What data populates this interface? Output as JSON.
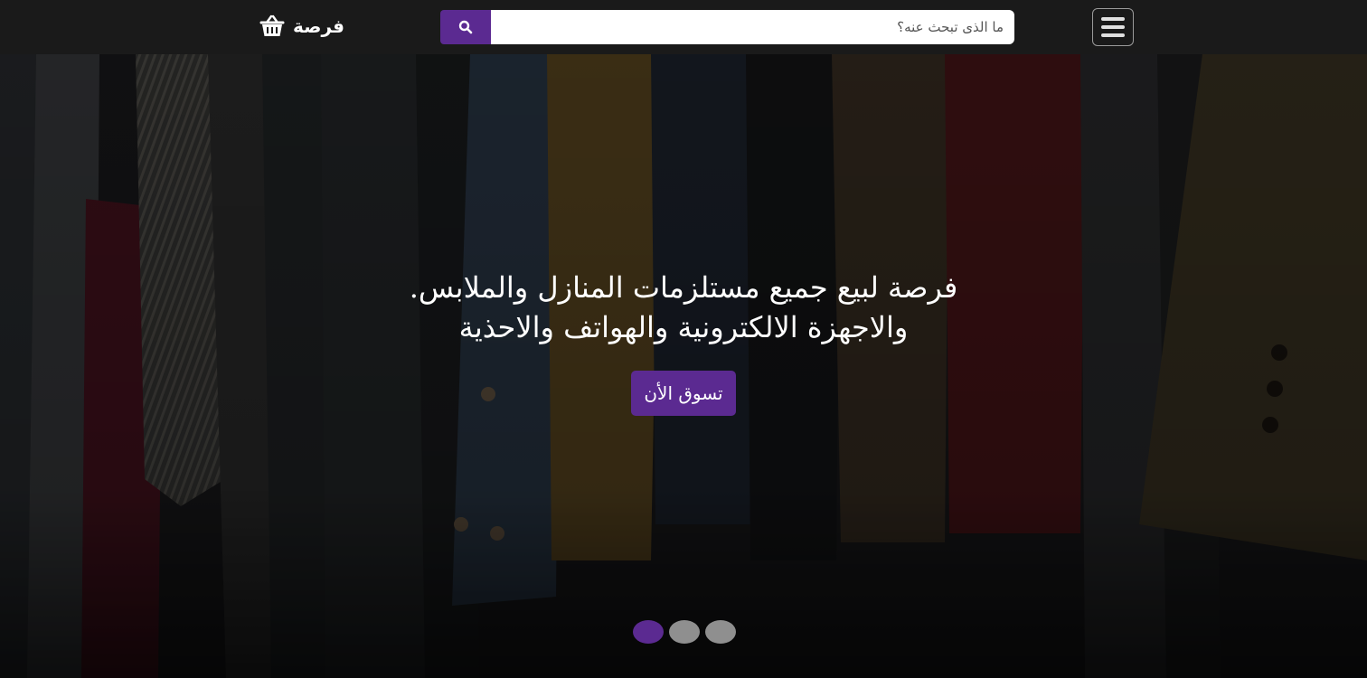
{
  "navbar": {
    "brand_label": "فرصة",
    "brand_icon": "basket-icon",
    "search": {
      "placeholder": "ما الذى تبحث عنه؟",
      "value": "",
      "button_icon": "search-icon"
    },
    "menu_icon": "hamburger-menu-icon"
  },
  "hero": {
    "caption_line_1": "فرصة لبيع جميع مستلزمات المنازل والملابس.",
    "caption_line_2": "والاجهزة الالكترونية والهواتف والاحذية",
    "cta_label": "تسوق الأن",
    "slides_count": 3,
    "active_slide": 0
  },
  "colors": {
    "accent": "#5b2a91",
    "navbar_bg": "#1a1a1a",
    "indicator_inactive": "#8f8f8f"
  }
}
